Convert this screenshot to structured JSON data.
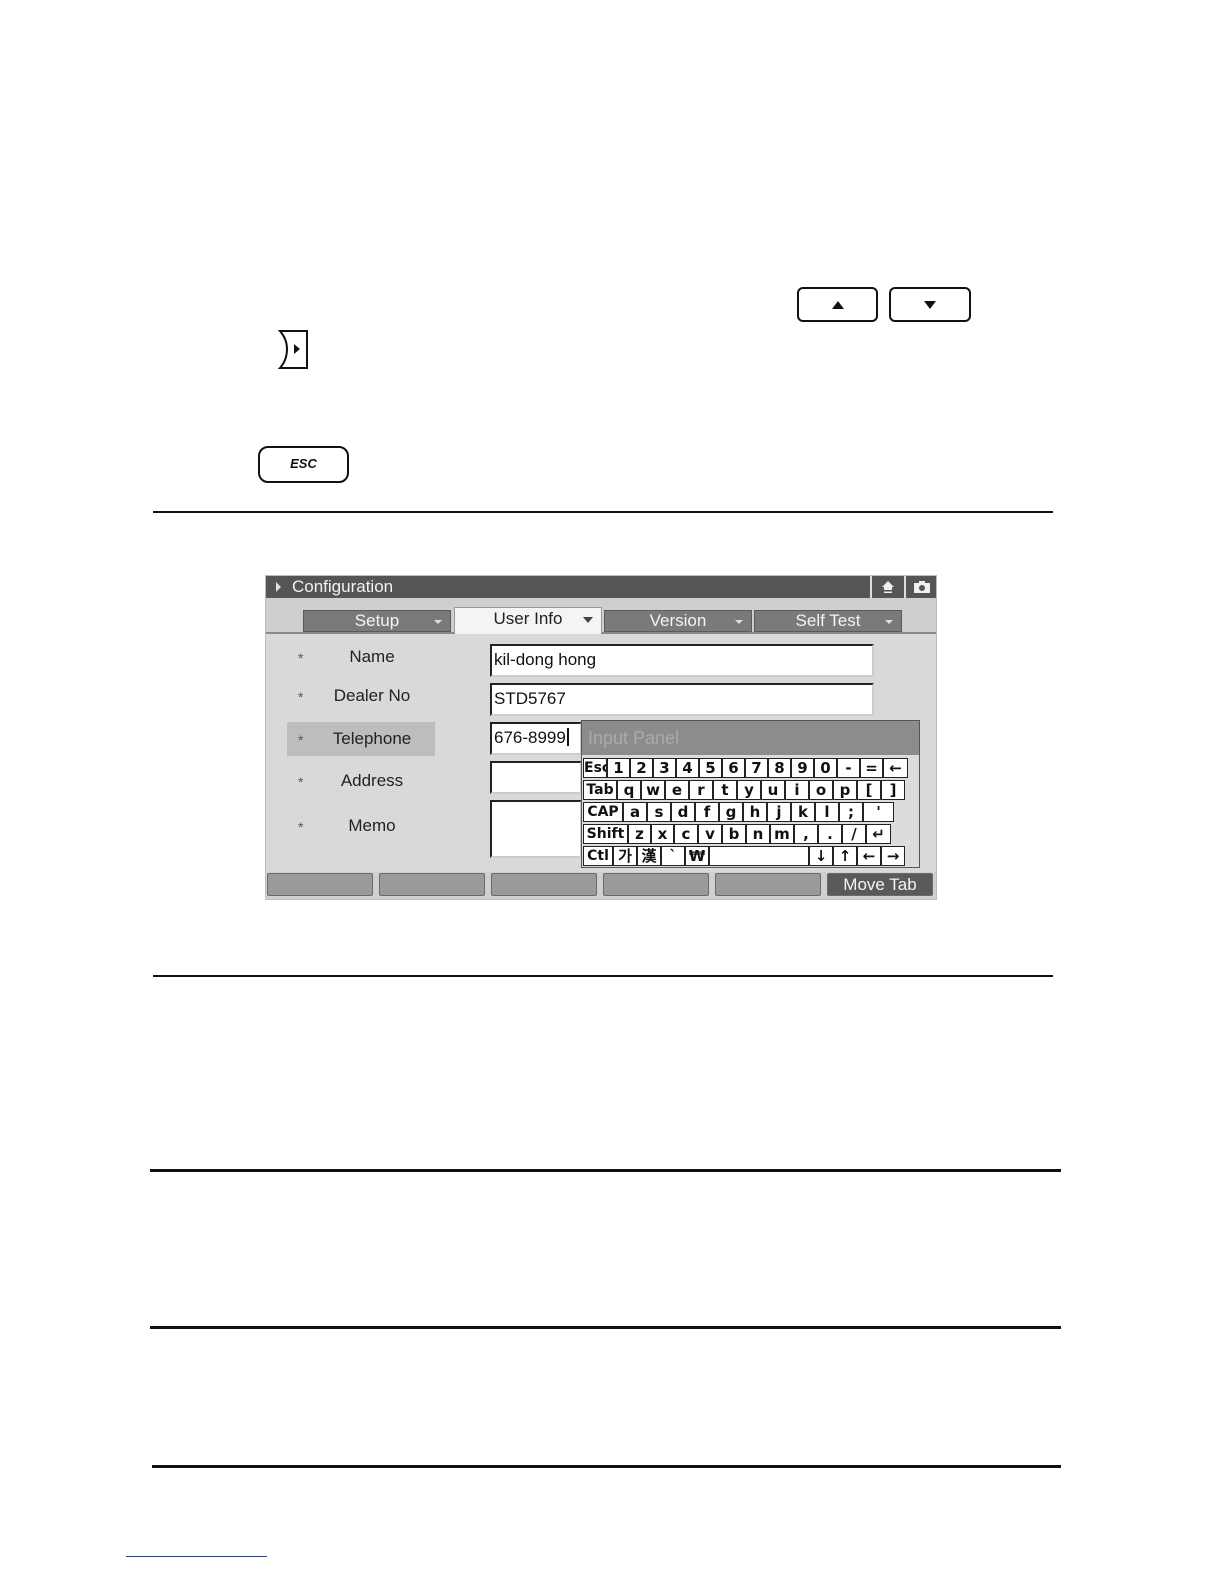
{
  "keys": {
    "esc_label": "ESC"
  },
  "window": {
    "title": "Configuration"
  },
  "tabs": [
    {
      "label": "Setup"
    },
    {
      "label": "User Info"
    },
    {
      "label": "Version"
    },
    {
      "label": "Self Test"
    }
  ],
  "form": {
    "fields": [
      {
        "marker": "*",
        "label": "Name",
        "value": "kil-dong hong"
      },
      {
        "marker": "*",
        "label": "Dealer No",
        "value": "STD5767"
      },
      {
        "marker": "*",
        "label": "Telephone",
        "value": "676-8999"
      },
      {
        "marker": "*",
        "label": "Address",
        "value": ""
      },
      {
        "marker": "*",
        "label": "Memo",
        "value": ""
      }
    ]
  },
  "input_panel": {
    "title": "Input Panel",
    "rows": [
      [
        "Esc",
        "1",
        "2",
        "3",
        "4",
        "5",
        "6",
        "7",
        "8",
        "9",
        "0",
        "-",
        "=",
        "←"
      ],
      [
        "Tab",
        "q",
        "w",
        "e",
        "r",
        "t",
        "y",
        "u",
        "i",
        "o",
        "p",
        "[",
        "]"
      ],
      [
        "CAP",
        "a",
        "s",
        "d",
        "f",
        "g",
        "h",
        "j",
        "k",
        "l",
        ";",
        "'"
      ],
      [
        "Shift",
        "z",
        "x",
        "c",
        "v",
        "b",
        "n",
        "m",
        ",",
        ".",
        "/",
        "↵"
      ],
      [
        "Ctl",
        "가",
        "漢",
        "`",
        "₩",
        " ",
        "↓",
        "↑",
        "←",
        "→"
      ]
    ]
  },
  "softkeys": [
    {
      "label": ""
    },
    {
      "label": ""
    },
    {
      "label": ""
    },
    {
      "label": ""
    },
    {
      "label": ""
    },
    {
      "label": "Move Tab"
    }
  ]
}
